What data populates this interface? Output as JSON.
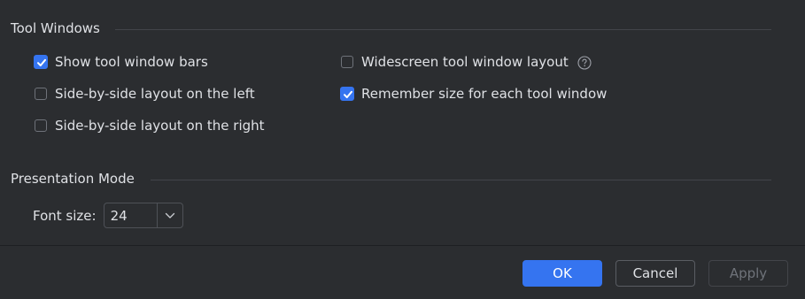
{
  "tool_windows": {
    "title": "Tool Windows",
    "options": [
      {
        "label": "Show tool window bars",
        "checked": true
      },
      {
        "label": "Side-by-side layout on the left",
        "checked": false
      },
      {
        "label": "Side-by-side layout on the right",
        "checked": false
      },
      {
        "label": "Widescreen tool window layout",
        "checked": false,
        "help_icon": "question-circle-icon"
      },
      {
        "label": "Remember size for each tool window",
        "checked": true
      }
    ]
  },
  "presentation_mode": {
    "title": "Presentation Mode",
    "font_size_label": "Font size:",
    "font_size_value": "24"
  },
  "footer": {
    "ok_label": "OK",
    "cancel_label": "Cancel",
    "apply_label": "Apply",
    "apply_enabled": false
  },
  "colors": {
    "accent": "#3574f0",
    "background": "#2b2d30",
    "text": "#dfe1e5",
    "disabled_text": "#6f737a"
  }
}
